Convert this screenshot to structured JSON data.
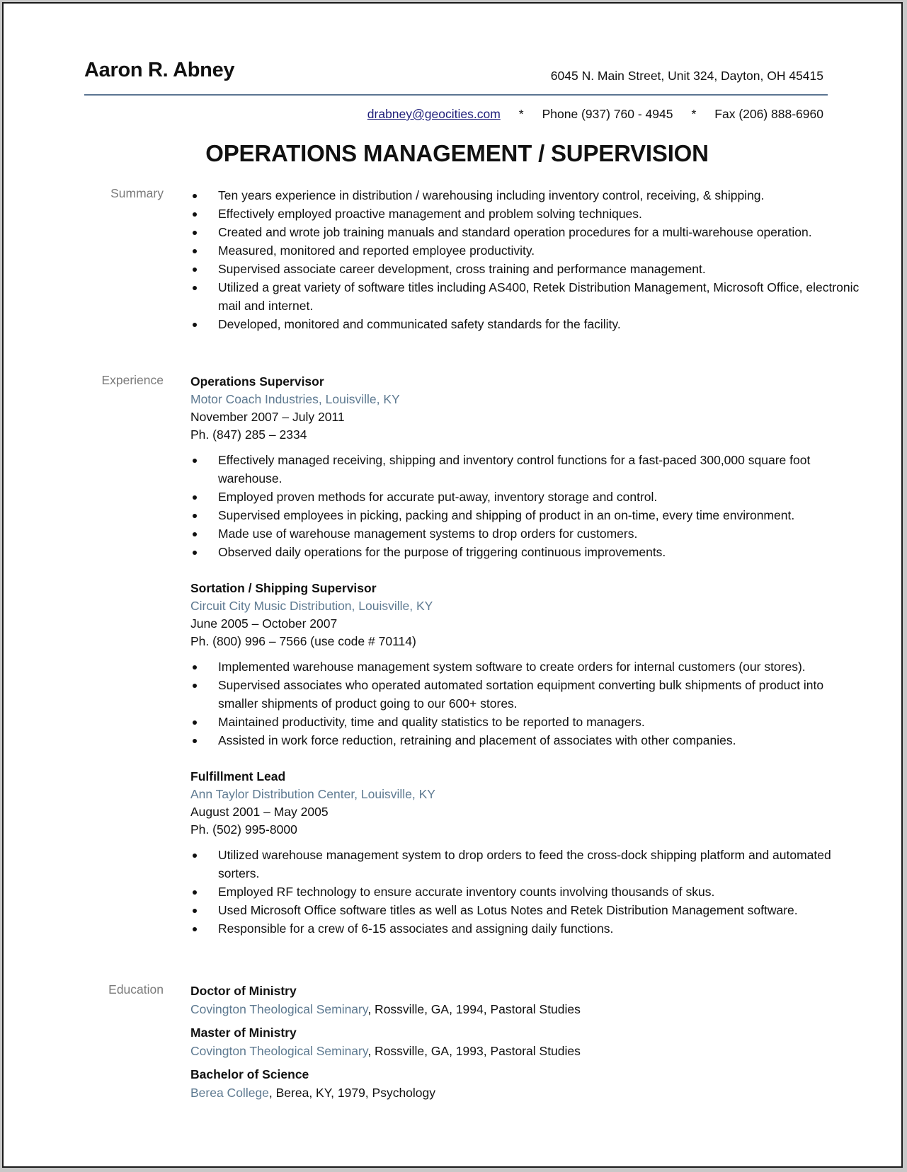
{
  "header": {
    "name": "Aaron R. Abney",
    "address": "6045 N. Main Street, Unit 324, Dayton, OH  45415",
    "email": "drabney@geocities.com",
    "separator": "*",
    "phone": "Phone (937) 760 - 4945",
    "fax": "Fax (206) 888-6960"
  },
  "title": "OPERATIONS MANAGEMENT / SUPERVISION",
  "summary": {
    "label": "Summary",
    "items": [
      "Ten years experience in distribution / warehousing including inventory control, receiving, & shipping.",
      "Effectively employed proactive management and problem solving techniques.",
      "Created and wrote job training manuals and standard operation procedures for a multi-warehouse operation.",
      "Measured, monitored and reported employee productivity.",
      "Supervised associate career development, cross training and performance management.",
      "Utilized a great variety of software titles including AS400, Retek Distribution Management, Microsoft Office, electronic mail and internet.",
      "Developed, monitored and communicated safety standards for the facility."
    ]
  },
  "experience": {
    "label": "Experience",
    "jobs": [
      {
        "title": "Operations Supervisor",
        "company": "Motor Coach Industries, Louisville, KY",
        "dates": "November 2007 – July 2011",
        "phone": "Ph. (847) 285 – 2334",
        "items": [
          "Effectively managed receiving, shipping and inventory control functions for a fast-paced 300,000 square foot warehouse.",
          "Employed proven methods for accurate put-away, inventory storage and control.",
          "Supervised employees in picking, packing and shipping of product in an on-time, every time environment.",
          "Made use of warehouse management systems to drop orders for customers.",
          "Observed daily operations for the purpose of triggering continuous improvements."
        ]
      },
      {
        "title": "Sortation / Shipping Supervisor",
        "company": "Circuit City Music Distribution, Louisville, KY",
        "dates": "June 2005 – October 2007",
        "phone": "Ph. (800) 996 – 7566 (use code # 70114)",
        "items": [
          "Implemented warehouse management system software to create orders for internal customers (our stores).",
          "Supervised associates who operated automated sortation equipment converting bulk shipments of product into smaller shipments of product going to our 600+ stores.",
          "Maintained productivity, time and quality statistics to be reported to managers.",
          "Assisted in work force reduction, retraining and placement of associates with other companies."
        ]
      },
      {
        "title": "Fulfillment Lead",
        "company": "Ann Taylor Distribution Center, Louisville, KY",
        "dates": "August 2001 – May 2005",
        "phone": "Ph. (502) 995-8000",
        "items": [
          "Utilized warehouse management system to drop orders to feed the cross-dock shipping platform and automated sorters.",
          "Employed RF technology to ensure accurate inventory counts involving thousands of skus.",
          "Used Microsoft Office software titles as well as Lotus Notes and Retek Distribution Management software.",
          "Responsible for a crew of 6-15 associates and assigning daily functions."
        ]
      }
    ]
  },
  "education": {
    "label": "Education",
    "degrees": [
      {
        "degree": "Doctor of Ministry",
        "school": "Covington Theological Seminary",
        "details": ", Rossville, GA, 1994, Pastoral Studies"
      },
      {
        "degree": "Master of Ministry",
        "school": "Covington Theological Seminary",
        "details": ", Rossville, GA, 1993, Pastoral Studies"
      },
      {
        "degree": "Bachelor of Science",
        "school": "Berea College",
        "details": ", Berea, KY, 1979, Psychology"
      }
    ]
  },
  "colors": {
    "accent_rule": "#5b7591",
    "company_text": "#5e7a91",
    "label_text": "#7a7a7a",
    "link": "#1f1f7a"
  }
}
